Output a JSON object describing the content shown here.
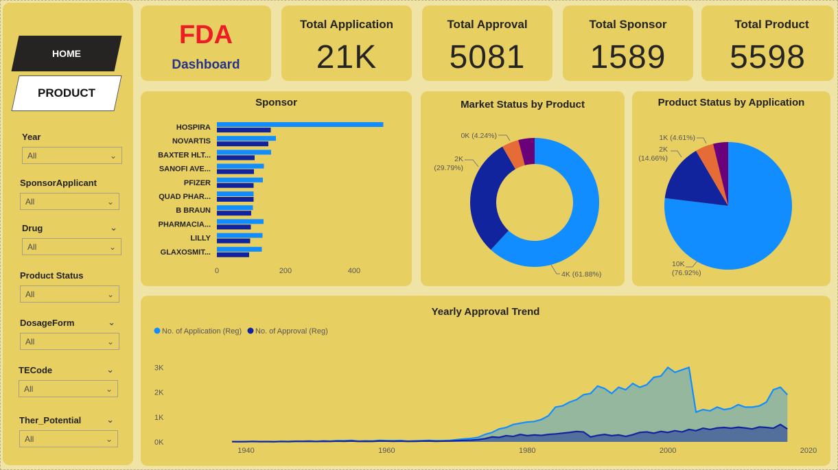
{
  "nav": {
    "home": "HOME",
    "product": "PRODUCT"
  },
  "slicers": [
    {
      "title": "Year",
      "value": "All"
    },
    {
      "title": "SponsorApplicant",
      "value": "All"
    },
    {
      "title": "Drug",
      "value": "All"
    },
    {
      "title": "Product Status",
      "value": "All"
    },
    {
      "title": "DosageForm",
      "value": "All"
    },
    {
      "title": "TECode",
      "value": "All"
    },
    {
      "title": "Ther_Potential",
      "value": "All"
    }
  ],
  "brand": {
    "title": "FDA",
    "subtitle": "Dashboard"
  },
  "kpis": [
    {
      "title": "Total Application",
      "value": "21K"
    },
    {
      "title": "Total Approval",
      "value": "5081"
    },
    {
      "title": "Total Sponsor",
      "value": "1589"
    },
    {
      "title": "Total Product",
      "value": "5598"
    }
  ],
  "colors": {
    "application": "#118dff",
    "approval": "#12239e",
    "orange": "#e66c37",
    "purple": "#6b007b",
    "panel": "#e8cf62",
    "background": "#f0e3a6"
  },
  "chart_data": [
    {
      "type": "bar",
      "title": "Sponsor",
      "categories": [
        "HOSPIRA",
        "NOVARTIS",
        "BAXTER HLT...",
        "SANOFI AVE...",
        "PFIZER",
        "QUAD PHAR...",
        "B BRAUN",
        "PHARMACIA...",
        "LILLY",
        "GLAXOSMIT..."
      ],
      "series": [
        {
          "values": [
            485,
            172,
            158,
            137,
            134,
            107,
            105,
            136,
            133,
            131
          ]
        },
        {
          "values": [
            157,
            150,
            110,
            108,
            107,
            107,
            100,
            99,
            97,
            94
          ]
        }
      ],
      "xticks": [
        "0",
        "200",
        "400"
      ],
      "xlim": [
        0,
        500
      ]
    },
    {
      "type": "pie",
      "variant": "donut",
      "title": "Market Status by Product",
      "slices": [
        {
          "label": "4K (61.88%)",
          "value": 61.88
        },
        {
          "label": "2K (29.79%)",
          "value": 29.79
        },
        {
          "label": "0K (4.24%)",
          "value": 4.24
        },
        {
          "value": 4.09
        }
      ]
    },
    {
      "type": "pie",
      "title": "Product Status by Application",
      "slices": [
        {
          "label": "10K (76.92%)",
          "value": 76.92
        },
        {
          "label": "2K (14.66%)",
          "value": 14.66
        },
        {
          "label": "1K (4.61%)",
          "value": 4.61
        },
        {
          "value": 3.81
        }
      ]
    },
    {
      "type": "area",
      "title": "Yearly Approval Trend",
      "legend": [
        "No. of Application (Reg)",
        "No. of Approval (Reg)"
      ],
      "legend_position": "top-left",
      "xlim": [
        1938,
        2020
      ],
      "ylim": [
        0,
        3400
      ],
      "xticks": [
        "1940",
        "1960",
        "1980",
        "2000",
        "2020"
      ],
      "yticks": [
        "0K",
        "1K",
        "2K",
        "3K"
      ],
      "series": [
        {
          "name": "No. of Application (Reg)",
          "x": [
            1938,
            1939,
            1940,
            1941,
            1942,
            1943,
            1944,
            1945,
            1946,
            1947,
            1948,
            1949,
            1950,
            1951,
            1952,
            1953,
            1954,
            1955,
            1956,
            1957,
            1958,
            1959,
            1960,
            1961,
            1962,
            1963,
            1964,
            1965,
            1966,
            1967,
            1968,
            1969,
            1970,
            1971,
            1972,
            1973,
            1974,
            1975,
            1976,
            1977,
            1978,
            1979,
            1980,
            1981,
            1982,
            1983,
            1984,
            1985,
            1986,
            1987,
            1988,
            1989,
            1990,
            1991,
            1992,
            1993,
            1994,
            1995,
            1996,
            1997,
            1998,
            1999,
            2000,
            2001,
            2002,
            2003,
            2004,
            2005,
            2006,
            2007,
            2008,
            2009,
            2010,
            2011,
            2012,
            2013,
            2014,
            2015,
            2016,
            2017
          ],
          "values": [
            10,
            10,
            10,
            20,
            10,
            15,
            10,
            20,
            15,
            30,
            25,
            35,
            20,
            40,
            30,
            50,
            45,
            60,
            30,
            40,
            35,
            60,
            50,
            45,
            55,
            30,
            40,
            50,
            60,
            45,
            50,
            60,
            90,
            120,
            140,
            180,
            300,
            380,
            520,
            580,
            700,
            750,
            800,
            820,
            900,
            1050,
            1400,
            1450,
            1600,
            1700,
            1900,
            1950,
            2250,
            2150,
            1950,
            2200,
            2100,
            2350,
            2200,
            2300,
            2600,
            2650,
            3000,
            2800,
            2900,
            3000,
            1200,
            1300,
            1250,
            1400,
            1300,
            1350,
            1500,
            1400,
            1400,
            1450,
            1600,
            2100,
            2200,
            1900
          ]
        },
        {
          "name": "No. of Approval (Reg)",
          "x": [
            1938,
            1939,
            1940,
            1941,
            1942,
            1943,
            1944,
            1945,
            1946,
            1947,
            1948,
            1949,
            1950,
            1951,
            1952,
            1953,
            1954,
            1955,
            1956,
            1957,
            1958,
            1959,
            1960,
            1961,
            1962,
            1963,
            1964,
            1965,
            1966,
            1967,
            1968,
            1969,
            1970,
            1971,
            1972,
            1973,
            1974,
            1975,
            1976,
            1977,
            1978,
            1979,
            1980,
            1981,
            1982,
            1983,
            1984,
            1985,
            1986,
            1987,
            1988,
            1989,
            1990,
            1991,
            1992,
            1993,
            1994,
            1995,
            1996,
            1997,
            1998,
            1999,
            2000,
            2001,
            2002,
            2003,
            2004,
            2005,
            2006,
            2007,
            2008,
            2009,
            2010,
            2011,
            2012,
            2013,
            2014,
            2015,
            2016,
            2017
          ],
          "values": [
            10,
            5,
            10,
            15,
            10,
            10,
            5,
            15,
            10,
            20,
            20,
            25,
            15,
            25,
            20,
            30,
            25,
            35,
            20,
            25,
            20,
            35,
            30,
            25,
            30,
            20,
            25,
            30,
            35,
            25,
            30,
            35,
            50,
            60,
            70,
            90,
            130,
            200,
            180,
            250,
            220,
            300,
            250,
            280,
            260,
            300,
            320,
            350,
            380,
            420,
            400,
            200,
            260,
            300,
            250,
            280,
            220,
            290,
            380,
            400,
            350,
            420,
            380,
            450,
            400,
            500,
            450,
            550,
            500,
            560,
            580,
            550,
            590,
            560,
            520,
            600,
            580,
            550,
            700,
            520
          ]
        }
      ]
    }
  ]
}
